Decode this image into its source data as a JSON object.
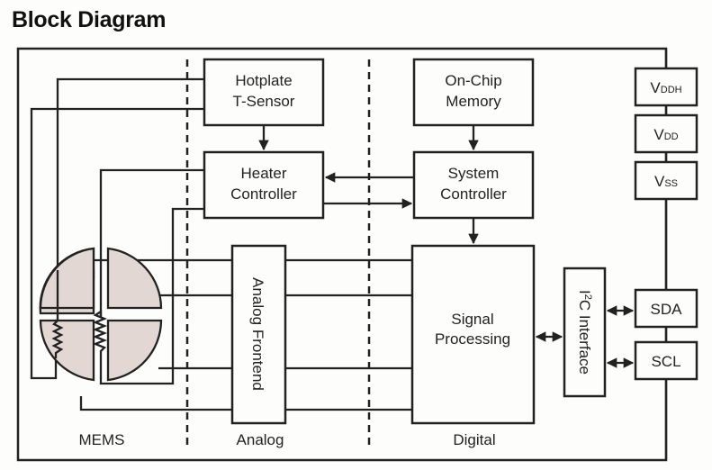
{
  "title": "Block Diagram",
  "blocks": {
    "hotplate": [
      "Hotplate",
      "T-Sensor"
    ],
    "heater": [
      "Heater",
      "Controller"
    ],
    "memory": [
      "On-Chip",
      "Memory"
    ],
    "system": [
      "System",
      "Controller"
    ],
    "frontend": "Analog Frontend",
    "signal": [
      "Signal",
      "Processing"
    ],
    "i2c": {
      "prefix": "I",
      "sup": "2",
      "rest": "C Interface"
    }
  },
  "pins": {
    "vddh": {
      "main": "V",
      "sub": "DDH"
    },
    "vdd": {
      "main": "V",
      "sub": "DD"
    },
    "vss": {
      "main": "V",
      "sub": "SS"
    },
    "sda": "SDA",
    "scl": "SCL"
  },
  "regions": [
    "MEMS",
    "Analog",
    "Digital"
  ],
  "colors": {
    "line": "#222222",
    "mems_fill": "#e2d7d3",
    "background": "#fdfdfb"
  }
}
